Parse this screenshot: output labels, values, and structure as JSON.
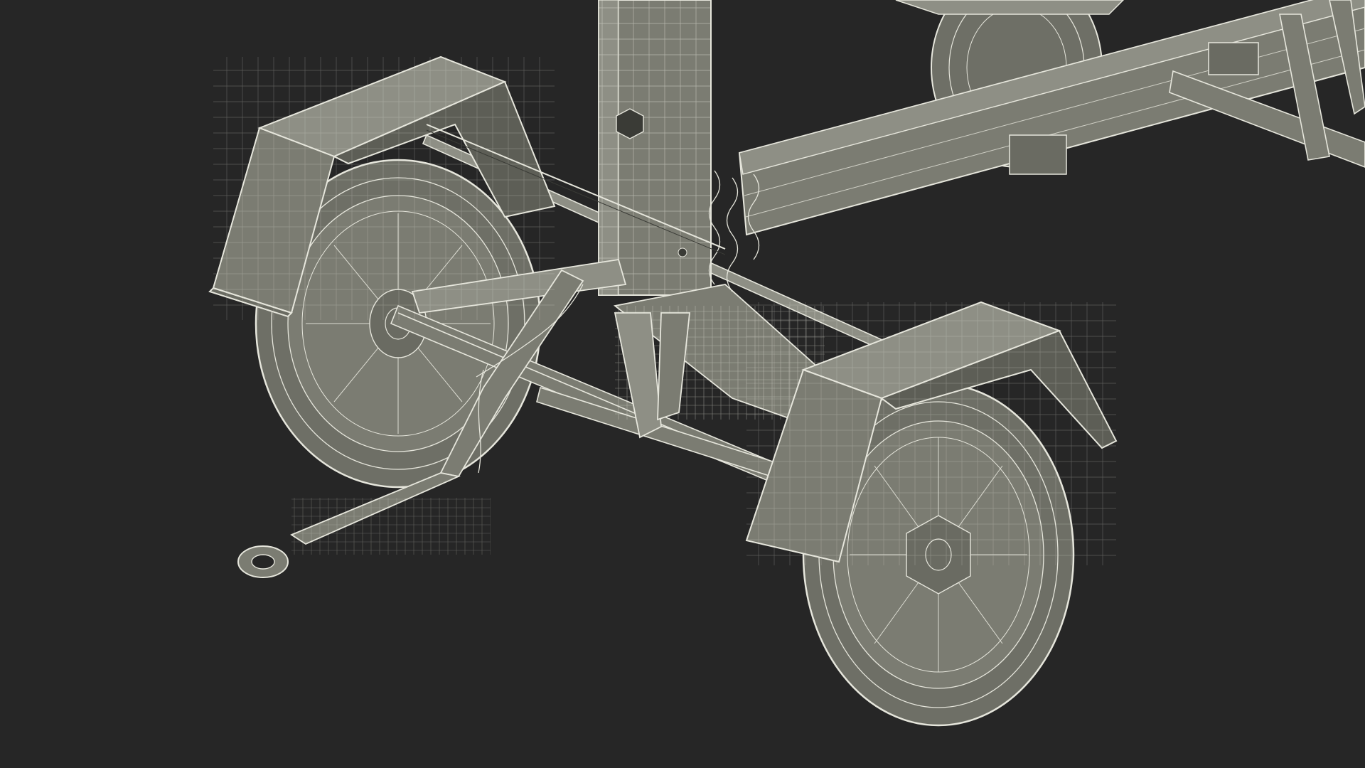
{
  "scene": {
    "subject": "trailer-wireframe-render",
    "background_color": "#262626",
    "surface_color": "#7b7c72",
    "surface_light_color": "#8e8f85",
    "surface_dark_color": "#5d5e56",
    "wire_color": "#e6e6dc",
    "wire_dark_color": "#3a3b36"
  }
}
